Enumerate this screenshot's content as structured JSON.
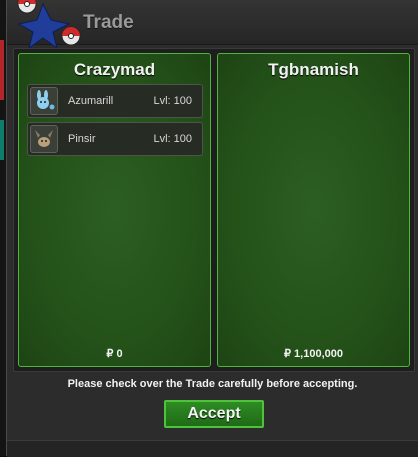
{
  "window": {
    "title": "Trade"
  },
  "trade": {
    "left": {
      "player": "Crazymad",
      "pokemon": [
        {
          "name": "Azumarill",
          "level": "Lvl: 100",
          "icon": "azumarill-icon"
        },
        {
          "name": "Pinsir",
          "level": "Lvl: 100",
          "icon": "pinsir-icon"
        }
      ],
      "money": "₽ 0"
    },
    "right": {
      "player": "Tgbnamish",
      "pokemon": [],
      "money": "₽ 1,100,000"
    }
  },
  "footer": {
    "notice": "Please check over the Trade carefully before accepting.",
    "accept_label": "Accept"
  },
  "colors": {
    "panel_green": "#245219",
    "panel_border": "#4fb53c",
    "accept_green": "#2e8b22"
  }
}
